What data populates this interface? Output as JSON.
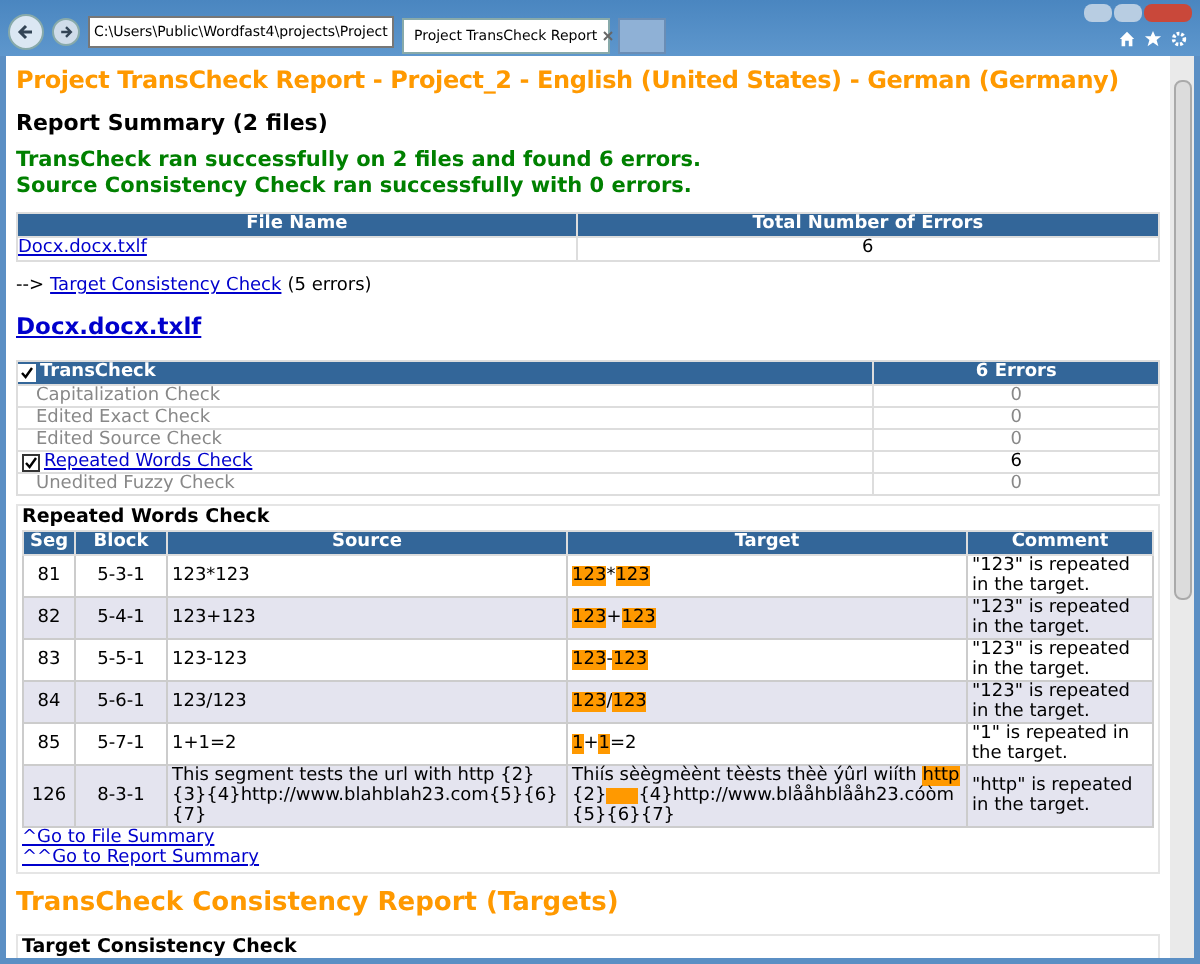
{
  "browser": {
    "address": "C:\\Users\\Public\\Wordfast4\\projects\\Project",
    "tabs": [
      {
        "label": "Project TransCheck Report",
        "selected": true
      }
    ]
  },
  "title": "Project TransCheck Report - Project_2 - English (United States) - German (Germany)",
  "summary": {
    "heading": "Report Summary (2 files)",
    "messages": [
      "TransCheck ran successfully on 2 files and found 6 errors.",
      "Source Consistency Check ran successfully with 0 errors."
    ]
  },
  "files_table": {
    "columns": [
      "File Name",
      "Total Number of Errors"
    ],
    "rows": [
      {
        "file": "Docx.docx.txlf",
        "errors": "6"
      }
    ]
  },
  "consistency_line": {
    "prefix": "-->",
    "link": "Target Consistency Check",
    "suffix": "(5 errors)"
  },
  "file_heading": "Docx.docx.txlf",
  "checks_table": {
    "header": {
      "label": "TransCheck",
      "checked": true,
      "errors": "6 Errors"
    },
    "rows": [
      {
        "label": "Capitalization Check",
        "count": "0",
        "active": false
      },
      {
        "label": "Edited Exact Check",
        "count": "0",
        "active": false
      },
      {
        "label": "Edited Source Check",
        "count": "0",
        "active": false
      },
      {
        "label": "Repeated Words Check",
        "count": "6",
        "active": true
      },
      {
        "label": "Unedited Fuzzy Check",
        "count": "0",
        "active": false
      }
    ]
  },
  "repeated": {
    "heading": "Repeated Words Check",
    "columns": [
      "Seg",
      "Block",
      "Source",
      "Target",
      "Comment"
    ],
    "rows": [
      {
        "seg": "81",
        "block": "5-3-1",
        "source": "123*123",
        "target": [
          {
            "text": "123",
            "highlight": true
          },
          {
            "text": "*",
            "highlight": false
          },
          {
            "text": "123",
            "highlight": true
          }
        ],
        "comment": "\"123\" is repeated in the target."
      },
      {
        "seg": "82",
        "block": "5-4-1",
        "source": "123+123",
        "target": [
          {
            "text": "123",
            "highlight": true
          },
          {
            "text": "+",
            "highlight": false
          },
          {
            "text": "123",
            "highlight": true
          }
        ],
        "comment": "\"123\" is repeated in the target."
      },
      {
        "seg": "83",
        "block": "5-5-1",
        "source": "123-123",
        "target": [
          {
            "text": "123",
            "highlight": true
          },
          {
            "text": "-",
            "highlight": false
          },
          {
            "text": "123",
            "highlight": true
          }
        ],
        "comment": "\"123\" is repeated in the target."
      },
      {
        "seg": "84",
        "block": "5-6-1",
        "source": "123/123",
        "target": [
          {
            "text": "123",
            "highlight": true
          },
          {
            "text": "/",
            "highlight": false
          },
          {
            "text": "123",
            "highlight": true
          }
        ],
        "comment": "\"123\" is repeated in the target."
      },
      {
        "seg": "85",
        "block": "5-7-1",
        "source": "1+1=2",
        "target": [
          {
            "text": "1",
            "highlight": true
          },
          {
            "text": "+",
            "highlight": false
          },
          {
            "text": "1",
            "highlight": true
          },
          {
            "text": "=2",
            "highlight": false
          }
        ],
        "comment": "\"1\" is repeated in the target."
      },
      {
        "seg": "126",
        "block": "8-3-1",
        "source": "This segment tests the url with http {2}{3}{4}http://www.blahblah23.com{5}{6}{7}",
        "target": [
          {
            "text": "Thiís sèègmèènt tèèsts thèè ýûrl wiíth ",
            "highlight": false
          },
          {
            "text": "http",
            "highlight": true
          },
          {
            "text": " {2}",
            "highlight": false
          },
          {
            "kind": "blank",
            "highlight": true
          },
          {
            "text": "{4}http://www.blååhblååh23.cóòm{5}{6}{7}",
            "highlight": false
          }
        ],
        "comment": "\"http\" is repeated in the target."
      }
    ],
    "links": [
      "^Go to File Summary",
      "^^Go to Report Summary"
    ]
  },
  "consistency": {
    "heading": "TransCheck Consistency Report (Targets)",
    "subheading": "Target Consistency Check"
  }
}
